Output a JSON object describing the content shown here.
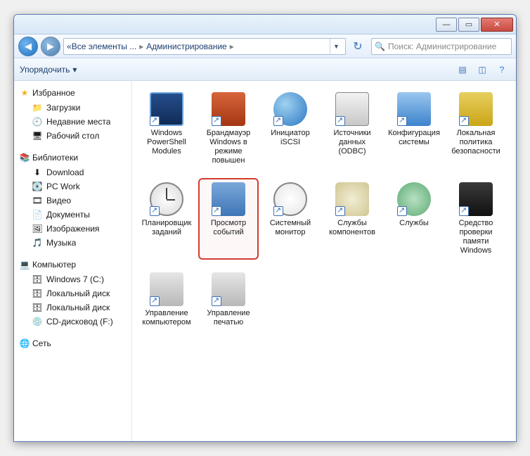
{
  "titlebar": {
    "controls": {
      "min": "—",
      "max": "▭",
      "close": "✕"
    }
  },
  "nav": {
    "breadcrumb": [
      "«",
      "Все элементы ...",
      "Администрирование"
    ],
    "search_placeholder": "Поиск: Администрирование"
  },
  "toolbar": {
    "organize": "Упорядочить",
    "organize_arrow": "▾"
  },
  "sidebar": {
    "groups": [
      {
        "name": "favorites",
        "head": "Избранное",
        "icon": "star-icon",
        "icon_char": "★",
        "items": [
          {
            "icon": "folder-icon",
            "char": "📁",
            "label": "Загрузки"
          },
          {
            "icon": "recent-icon",
            "char": "🕘",
            "label": "Недавние места"
          },
          {
            "icon": "desktop-icon",
            "char": "🖥",
            "label": "Рабочий стол"
          }
        ]
      },
      {
        "name": "libraries",
        "head": "Библиотеки",
        "icon": "libraries-icon",
        "icon_char": "📚",
        "items": [
          {
            "icon": "download-icon",
            "char": "⬇",
            "label": "Download"
          },
          {
            "icon": "disk-icon",
            "char": "💽",
            "label": "PC Work"
          },
          {
            "icon": "video-icon",
            "char": "🎞",
            "label": "Видео"
          },
          {
            "icon": "documents-icon",
            "char": "📄",
            "label": "Документы"
          },
          {
            "icon": "pictures-icon",
            "char": "🖼",
            "label": "Изображения"
          },
          {
            "icon": "music-icon",
            "char": "🎵",
            "label": "Музыка"
          }
        ]
      },
      {
        "name": "computer",
        "head": "Компьютер",
        "icon": "computer-icon",
        "icon_char": "💻",
        "items": [
          {
            "icon": "drive-icon",
            "char": "🗄",
            "label": "Windows 7 (C:)"
          },
          {
            "icon": "drive-icon",
            "char": "🗄",
            "label": "Локальный диск"
          },
          {
            "icon": "drive-icon",
            "char": "🗄",
            "label": "Локальный диск"
          },
          {
            "icon": "cd-icon",
            "char": "💿",
            "label": "CD-дисковод (F:)"
          }
        ]
      },
      {
        "name": "network",
        "head": "Сеть",
        "icon": "network-icon",
        "icon_char": "🌐",
        "items": []
      }
    ]
  },
  "content": {
    "items": [
      {
        "id": "powershell",
        "label": "Windows PowerShell Modules",
        "icon_class": "ic-ps",
        "highlight": false
      },
      {
        "id": "firewall",
        "label": "Брандмауэр Windows в режиме повышен",
        "icon_class": "ic-fw",
        "highlight": false
      },
      {
        "id": "iscsi",
        "label": "Инициатор iSCSI",
        "icon_class": "ic-globe",
        "highlight": false
      },
      {
        "id": "odbc",
        "label": "Источники данных (ODBC)",
        "icon_class": "ic-data",
        "highlight": false
      },
      {
        "id": "sysconfig",
        "label": "Конфигурация системы",
        "icon_class": "ic-conf",
        "highlight": false
      },
      {
        "id": "secpol",
        "label": "Локальная политика безопасности",
        "icon_class": "ic-sec",
        "highlight": false
      },
      {
        "id": "scheduler",
        "label": "Планировщик заданий",
        "icon_class": "ic-clock",
        "extra_class": "clockhand",
        "highlight": false
      },
      {
        "id": "eventvwr",
        "label": "Просмотр событий",
        "icon_class": "ic-book",
        "highlight": true
      },
      {
        "id": "perfmon",
        "label": "Системный монитор",
        "icon_class": "ic-meter",
        "highlight": false
      },
      {
        "id": "compsvc",
        "label": "Службы компонентов",
        "icon_class": "ic-gears",
        "highlight": false
      },
      {
        "id": "services",
        "label": "Службы",
        "icon_class": "ic-gear",
        "highlight": false
      },
      {
        "id": "memdiag",
        "label": "Средство проверки памяти Windows",
        "icon_class": "ic-chip",
        "highlight": false
      },
      {
        "id": "compmgmt",
        "label": "Управление компьютером",
        "icon_class": "ic-pc",
        "highlight": false
      },
      {
        "id": "printmgmt",
        "label": "Управление печатью",
        "icon_class": "ic-print",
        "highlight": false
      }
    ]
  }
}
